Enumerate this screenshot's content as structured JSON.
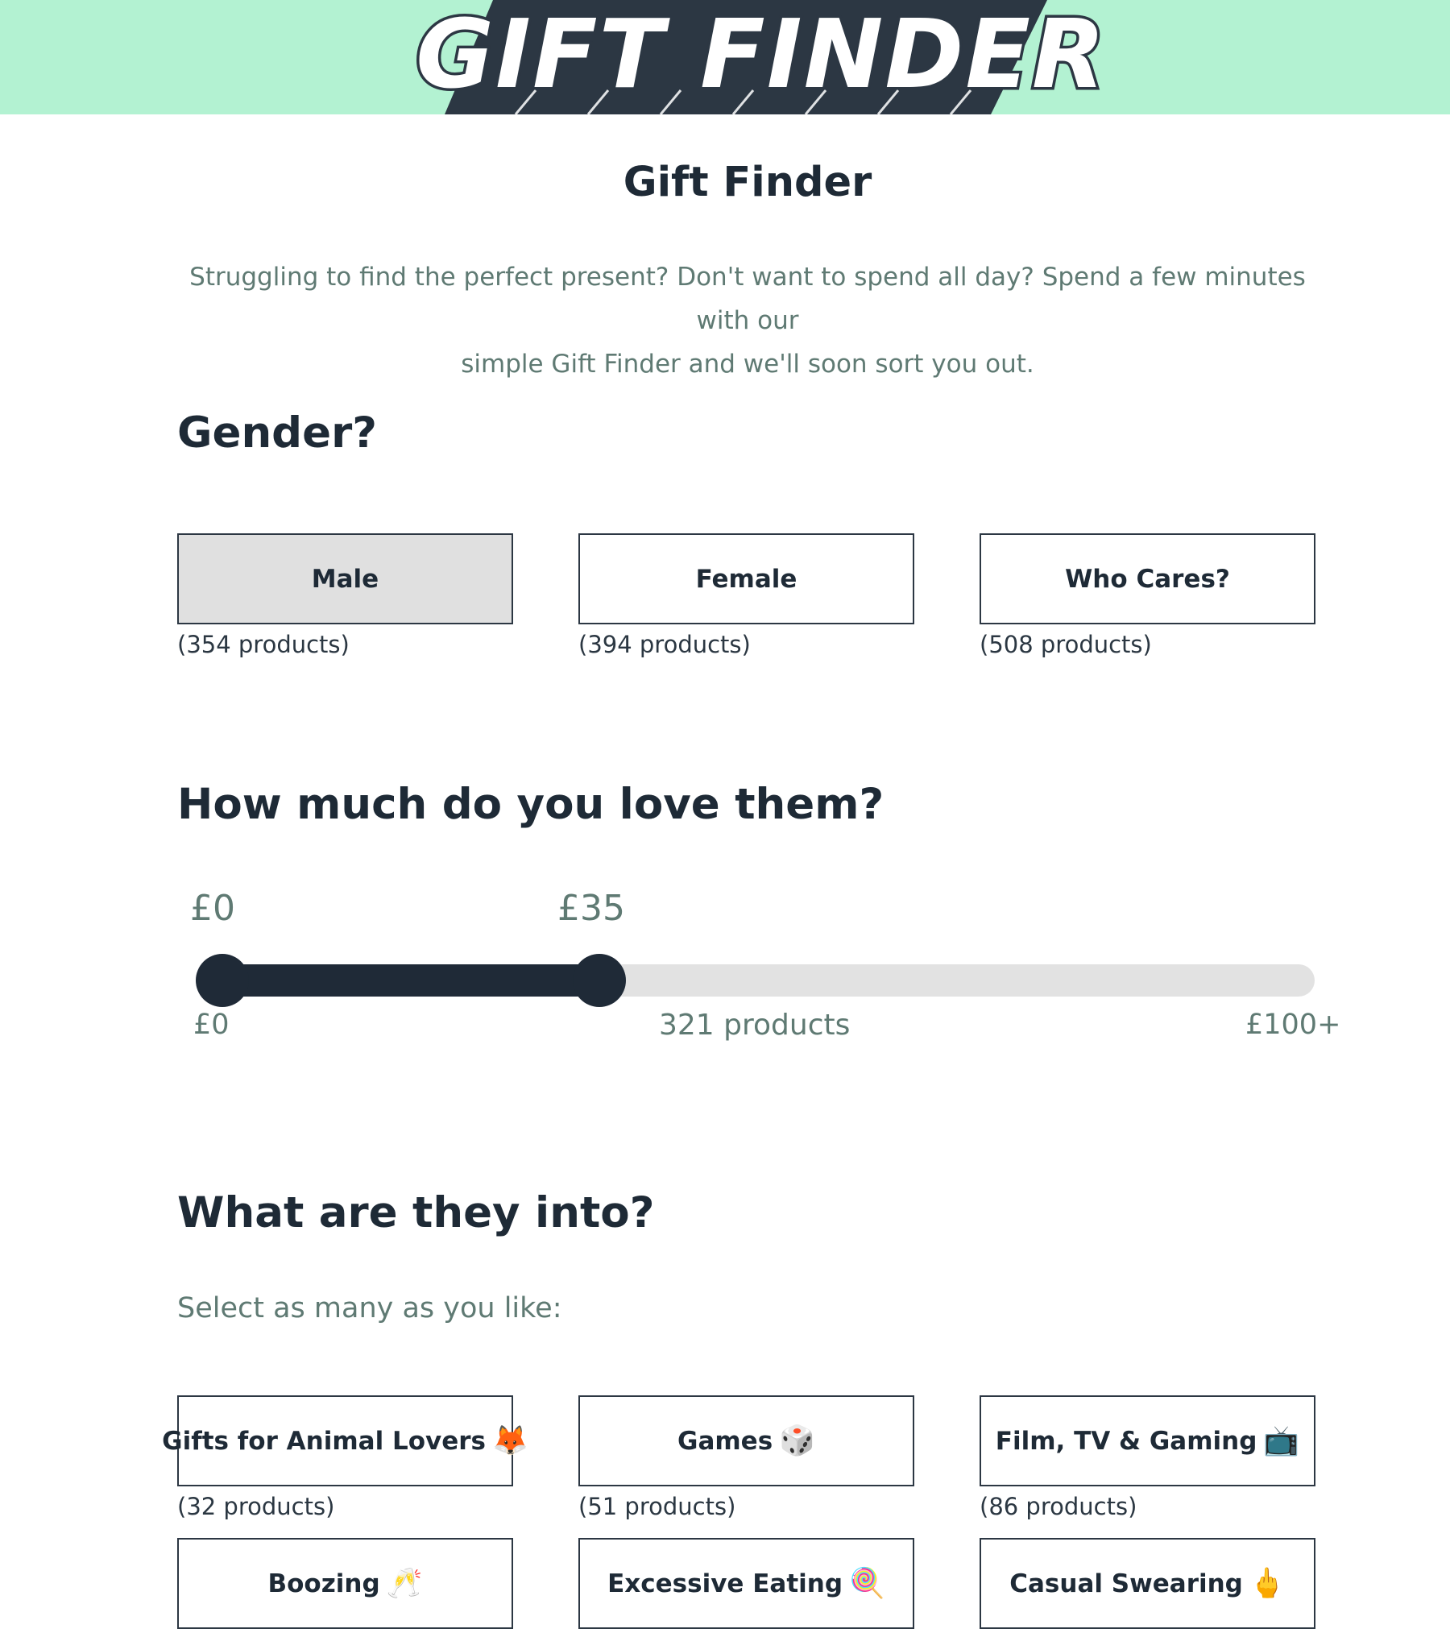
{
  "banner": {
    "logo_text": "GIFT FINDER",
    "background_color": "#b3f2d2",
    "logo_shadow_color": "#2c3743"
  },
  "page": {
    "title": "Gift Finder",
    "intro_line1": "Struggling to find the perfect present? Don't want to spend all day? Spend a few minutes with our",
    "intro_line2": "simple Gift Finder and we'll soon sort you out."
  },
  "gender": {
    "heading": "Gender?",
    "options": [
      {
        "label": "Male",
        "count": "(354 products)",
        "selected": true
      },
      {
        "label": "Female",
        "count": "(394 products)",
        "selected": false
      },
      {
        "label": "Who Cares?",
        "count": "(508 products)",
        "selected": false
      }
    ]
  },
  "budget": {
    "heading": "How much do you love them?",
    "min_value_label": "£0",
    "max_value_label": "£35",
    "selected_min": 0,
    "selected_max": 35,
    "range_max": 100,
    "scale_min_label": "£0",
    "scale_max_label": "£100+",
    "product_count": "321 products",
    "fill_color": "#1f2a37",
    "track_color": "#e2e2e2"
  },
  "interests": {
    "heading": "What are they into?",
    "subheading": "Select as many as you like:",
    "options": [
      {
        "label": "Gifts for Animal Lovers",
        "emoji": "🦊",
        "count": "(32 products)"
      },
      {
        "label": "Games",
        "emoji": "🎲",
        "count": "(51 products)"
      },
      {
        "label": "Film, TV & Gaming",
        "emoji": "📺",
        "count": "(86 products)"
      },
      {
        "label": "Boozing",
        "emoji": "🥂",
        "count": ""
      },
      {
        "label": "Excessive Eating",
        "emoji": "🍭",
        "count": ""
      },
      {
        "label": "Casual Swearing",
        "emoji": "🖕",
        "count": ""
      }
    ]
  }
}
